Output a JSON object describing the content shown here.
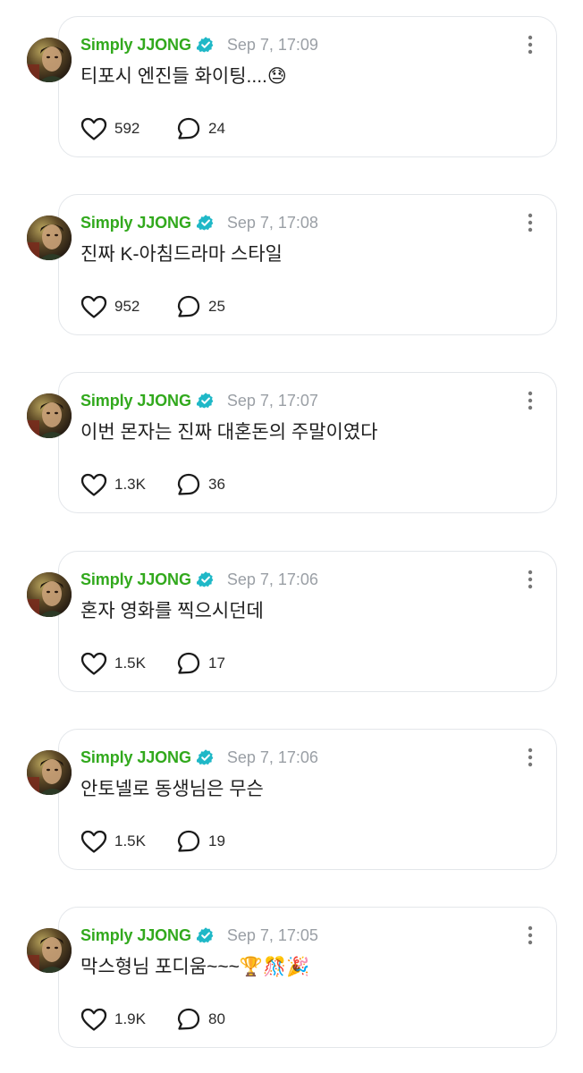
{
  "colors": {
    "author_green": "#32a91d",
    "verified_teal": "#1fb8c7",
    "timestamp_gray": "#9a9fa5",
    "card_border": "#e3e6ea"
  },
  "icons": {
    "like": "heart-outline-icon",
    "reply": "speech-bubble-outline-icon",
    "more": "vertical-ellipsis-icon",
    "verified": "verified-badge-icon"
  },
  "posts": [
    {
      "author": "Simply JJONG",
      "timestamp": "Sep 7, 17:09",
      "text": "티포시 엔진들 화이팅....",
      "emoji": "😓",
      "likes": "592",
      "replies": "24"
    },
    {
      "author": "Simply JJONG",
      "timestamp": "Sep 7, 17:08",
      "text": "진짜 K-아침드라마 스타일",
      "emoji": "",
      "likes": "952",
      "replies": "25"
    },
    {
      "author": "Simply JJONG",
      "timestamp": "Sep 7, 17:07",
      "text": "이번 몬자는 진짜 대혼돈의 주말이였다",
      "emoji": "",
      "likes": "1.3K",
      "replies": "36"
    },
    {
      "author": "Simply JJONG",
      "timestamp": "Sep 7, 17:06",
      "text": "혼자 영화를 찍으시던데",
      "emoji": "",
      "likes": "1.5K",
      "replies": "17"
    },
    {
      "author": "Simply JJONG",
      "timestamp": "Sep 7, 17:06",
      "text": "안토넬로 동생님은 무슨",
      "emoji": "",
      "likes": "1.5K",
      "replies": "19"
    },
    {
      "author": "Simply JJONG",
      "timestamp": "Sep 7, 17:05",
      "text": "막스형님 포디움~~~",
      "emoji": "🏆🎊🎉",
      "likes": "1.9K",
      "replies": "80"
    }
  ]
}
